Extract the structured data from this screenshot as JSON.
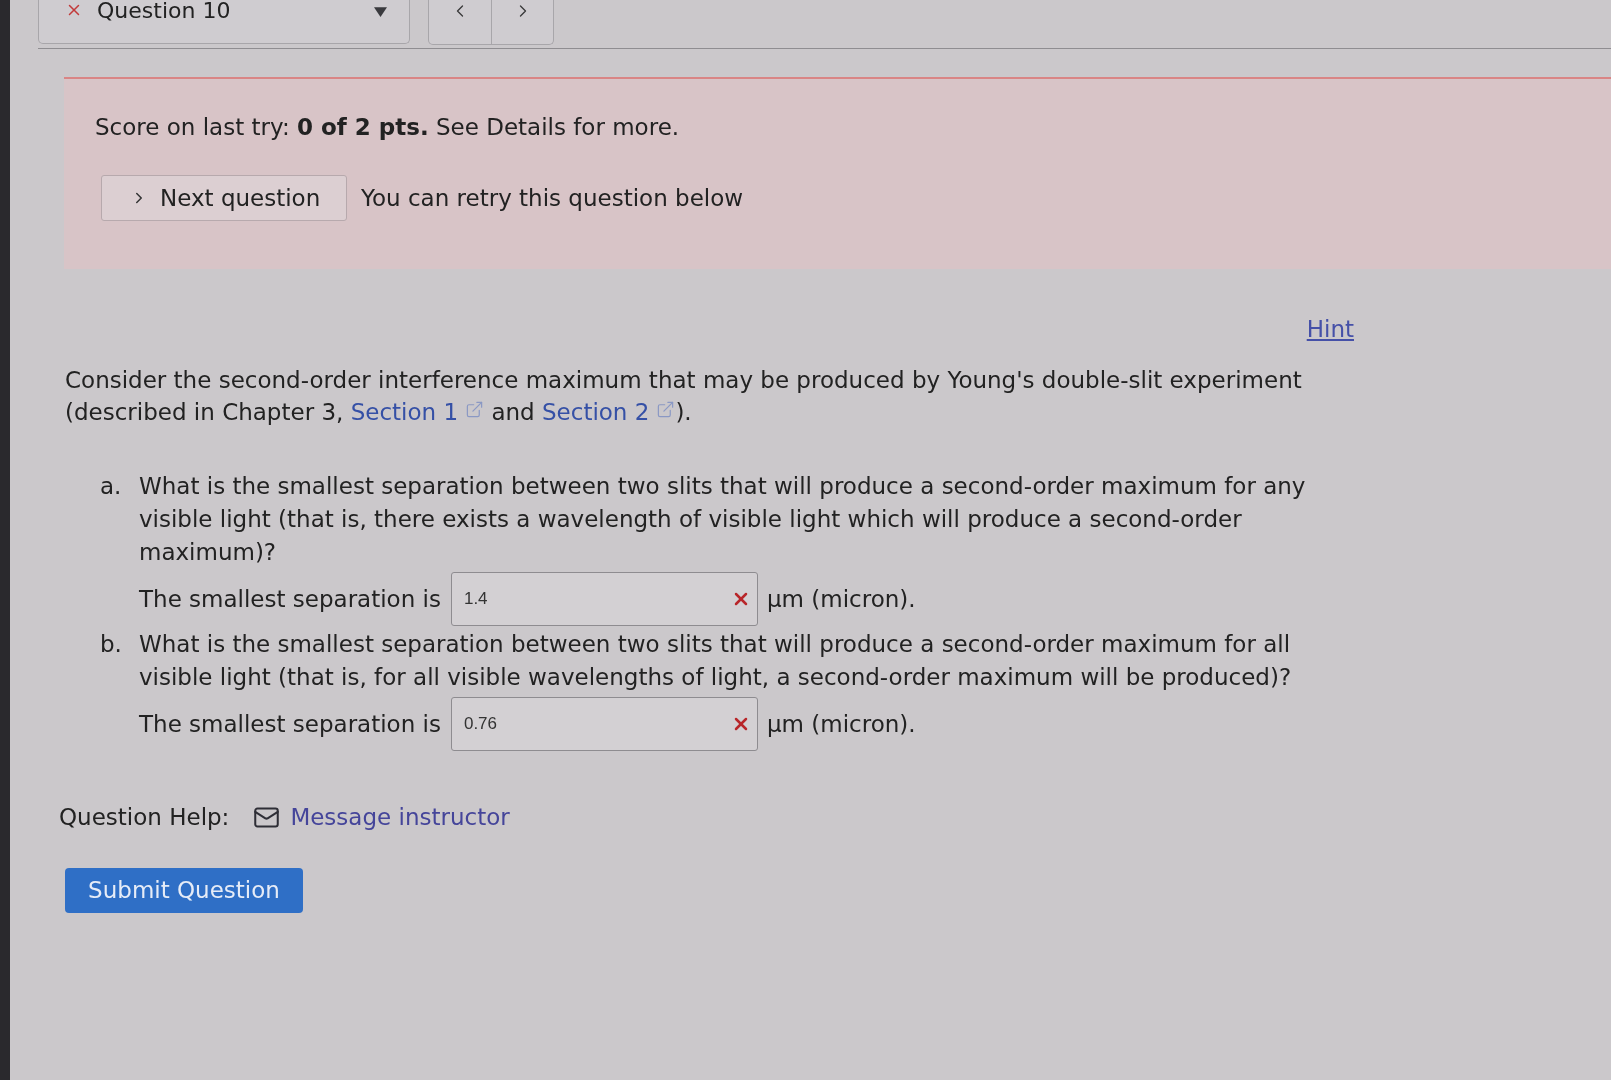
{
  "question_nav": {
    "question_select": {
      "label": "Question 10",
      "incorrect": true
    },
    "nav_buttons": [
      {
        "kind": "previous"
      },
      {
        "kind": "next"
      }
    ]
  },
  "score_banner": {
    "score_text": "Score on last try: **0 of 2 pts.** See Details for more.",
    "next_button": "Next question",
    "retry_text": "You can retry this question below"
  },
  "hint_link": "Hint",
  "question": {
    "segments": [
      {
        "kind": "text",
        "text": "Consider the second-order interference maximum that may be produced by Young's double-slit experiment (described in Chapter 3, "
      },
      {
        "kind": "link",
        "text": "Section 1"
      },
      {
        "kind": "text",
        "text": " and "
      },
      {
        "kind": "link",
        "text": "Section 2"
      },
      {
        "kind": "text",
        "text": ")."
      }
    ]
  },
  "parts": [
    {
      "marker": "a.",
      "text": "What is the smallest separation between two slits that will produce a second-order maximum for any visible light (that is, there exists a wavelength of visible light which will produce a second-order maximum)?",
      "answer_label": "The smallest separation is",
      "value": "1.4",
      "incorrect": true,
      "unit": "μm (micron)."
    },
    {
      "marker": "b.",
      "text": "What is the smallest separation between two slits that will produce a second-order maximum for all visible light (that is, for all visible wavelengths of light, a second-order maximum will be produced)?",
      "answer_label": "The smallest separation is",
      "value": "0.76",
      "incorrect": true,
      "unit": "μm (micron)."
    }
  ],
  "question_help": {
    "label": "Question Help:",
    "link": "Message instructor"
  },
  "submit_button": "Submit Question"
}
